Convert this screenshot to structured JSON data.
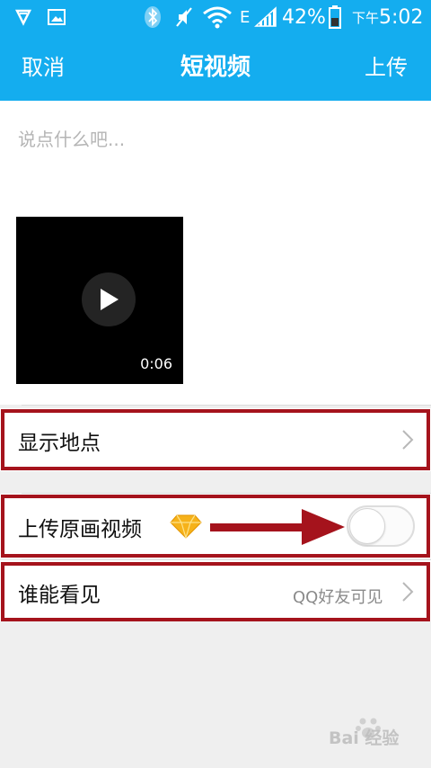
{
  "status_bar": {
    "carrier_indicator": "E",
    "battery": "42%",
    "time": "下午5:02",
    "icons": [
      "vpn-shield-icon",
      "gallery-notification-icon",
      "bluetooth-icon",
      "mute-icon",
      "wifi-icon",
      "signal-icon",
      "battery-icon"
    ]
  },
  "header": {
    "cancel_label": "取消",
    "title": "短视频",
    "upload_label": "上传"
  },
  "composer": {
    "placeholder": "说点什么吧..."
  },
  "video": {
    "duration": "0:06"
  },
  "settings": {
    "location_label": "显示地点",
    "original_video_label": "上传原画视频",
    "original_video_enabled": false,
    "visibility_label": "谁能看见",
    "visibility_value": "QQ好友可见"
  },
  "colors": {
    "accent": "#14adef",
    "annotation_red": "#a5131c",
    "background": "#efefef"
  },
  "watermark": {
    "text": "Bai 经验"
  }
}
